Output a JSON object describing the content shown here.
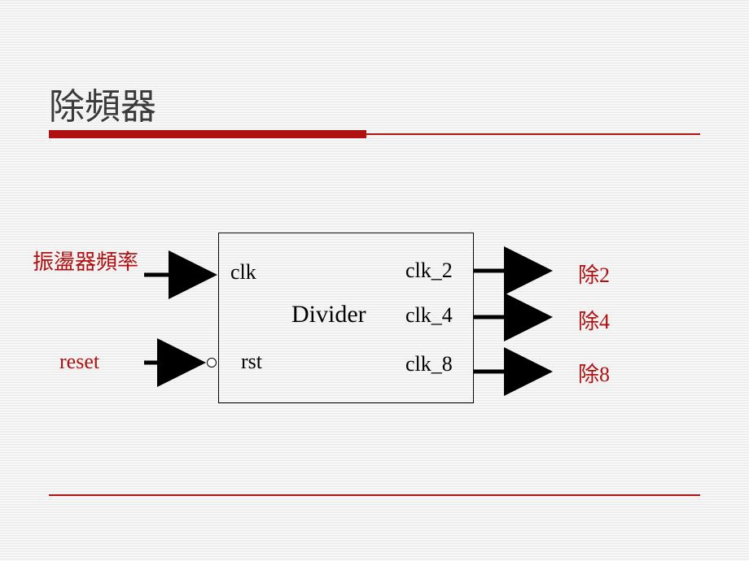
{
  "title": "除頻器",
  "block": {
    "name": "Divider",
    "inputs": {
      "clk": {
        "port": "clk",
        "label": "振盪器頻率"
      },
      "rst": {
        "port": "rst",
        "label": "reset"
      }
    },
    "outputs": {
      "clk2": {
        "port": "clk_2",
        "label": "除2"
      },
      "clk4": {
        "port": "clk_4",
        "label": "除4"
      },
      "clk8": {
        "port": "clk_8",
        "label": "除8"
      }
    }
  },
  "colors": {
    "accent": "#b01010",
    "text": "#3b3b3b"
  }
}
